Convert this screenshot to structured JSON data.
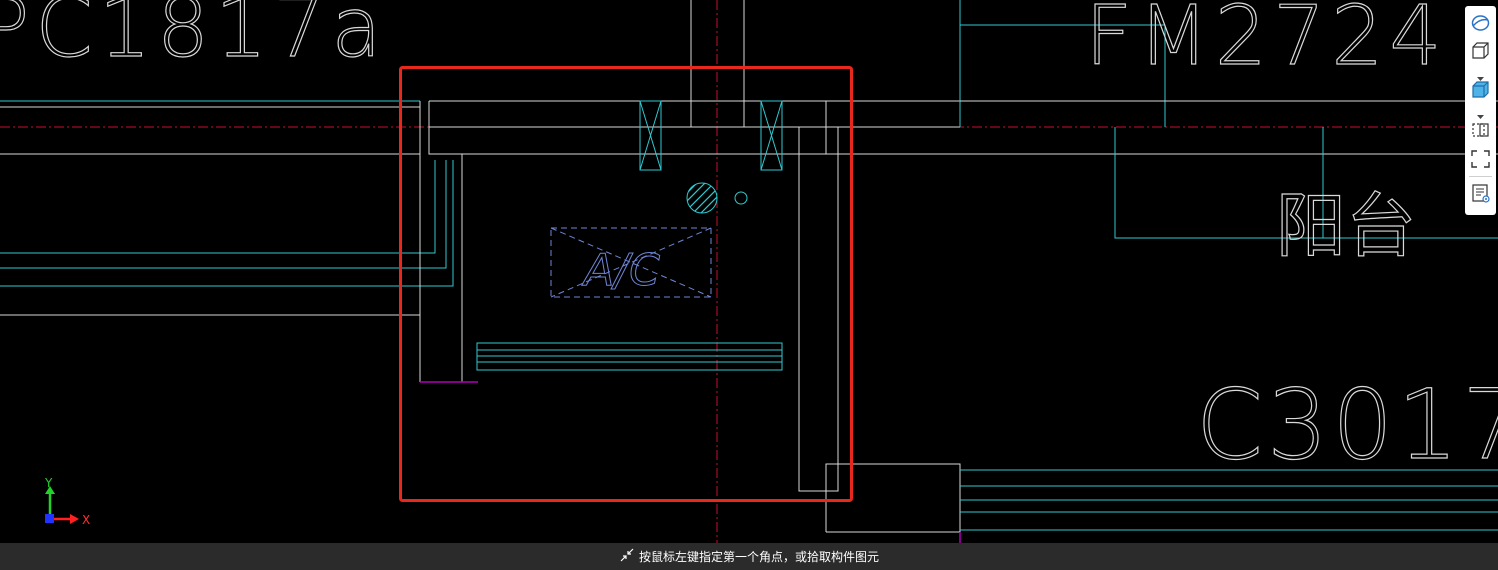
{
  "drawing": {
    "labels": {
      "top_left_code": "PC1817a",
      "top_right_code": "FM2724",
      "balcony": "阳台",
      "window_code": "C3017",
      "ac_unit": "A/C"
    },
    "axis": {
      "x_label": "X",
      "y_label": "Y"
    }
  },
  "colors": {
    "background": "#000000",
    "wall_white": "#d9d9d9",
    "cyan": "#2fc9cf",
    "selection_red": "#e8271d",
    "center_line": "#c8102e",
    "ac_blue": "#6f86d6",
    "magenta": "#b000b8"
  },
  "toolbar": {
    "icons": [
      "orbit-icon",
      "cube-wireframe-icon",
      "dropdown-arrow-icon",
      "cube-shaded-icon",
      "dropdown-arrow-icon",
      "section-box-icon",
      "fit-view-icon",
      "properties-view-icon"
    ]
  },
  "statusbar": {
    "prompt": "按鼠标左键指定第一个角点，或拾取构件图元"
  }
}
